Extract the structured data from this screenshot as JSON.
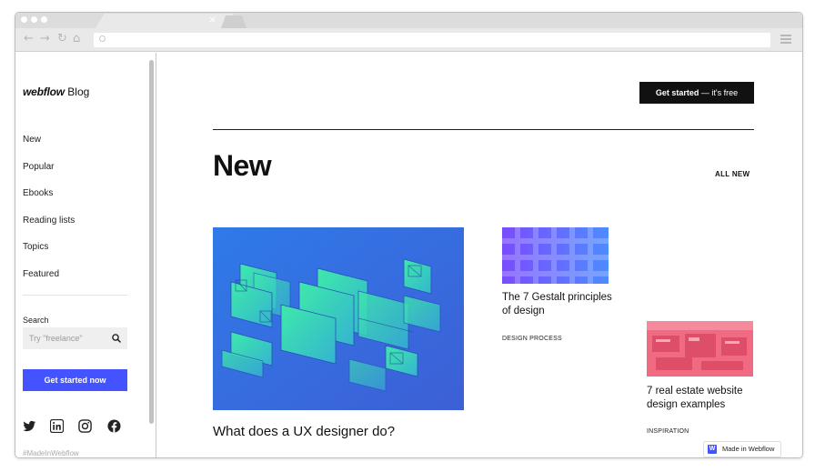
{
  "browser": {
    "tab_close": "×"
  },
  "sidebar": {
    "logo_brand": "webflow",
    "logo_suffix": "Blog",
    "nav": [
      {
        "label": "New"
      },
      {
        "label": "Popular"
      },
      {
        "label": "Ebooks"
      },
      {
        "label": "Reading lists"
      },
      {
        "label": "Topics"
      },
      {
        "label": "Featured"
      }
    ],
    "search_label": "Search",
    "search_placeholder": "Try \"freelance\"",
    "cta_label": "Get started now",
    "hashtag": "#MadeInWebflow"
  },
  "main": {
    "cta_bold": "Get started",
    "cta_rest": " — it's free",
    "heading": "New",
    "all_new": "ALL NEW",
    "featured_title": "What does a UX designer do?",
    "cards": [
      {
        "title": "The 7 Gestalt principles of design",
        "tag": "DESIGN PROCESS"
      },
      {
        "title": "7 real estate website design examples",
        "tag": "INSPIRATION"
      }
    ]
  },
  "badge": {
    "label": "Made in Webflow",
    "logo": "W"
  },
  "colors": {
    "accent": "#4353ff",
    "cta_dark": "#111111",
    "featured_bg": "#3a6ee0",
    "featured_shapes": "#3fe0a0",
    "card1_bg": "#6a5cff",
    "card2_bg": "#f2607a"
  },
  "icons": [
    "back-icon",
    "forward-icon",
    "reload-icon",
    "home-icon",
    "search-icon",
    "menu-icon",
    "twitter-icon",
    "linkedin-icon",
    "instagram-icon",
    "facebook-icon"
  ]
}
